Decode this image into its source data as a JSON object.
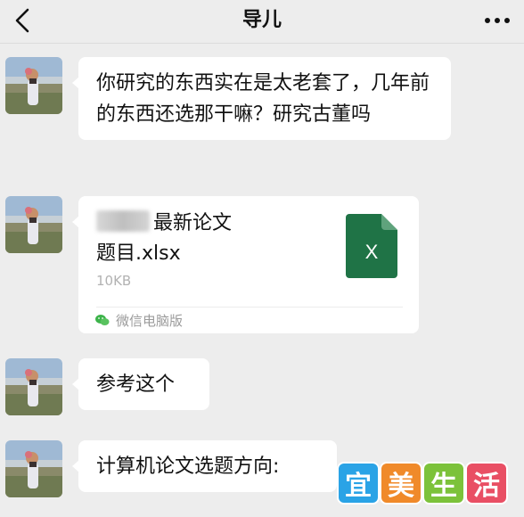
{
  "header": {
    "title": "导儿"
  },
  "messages": {
    "m1": "你研究的东西实在是太老套了，几年前的东西还选那干嘛？研究古董吗",
    "file": {
      "name_line1": "最新论文",
      "name_line2": "题目.xlsx",
      "size": "10KB",
      "source": "微信电脑版",
      "badge": "X"
    },
    "m3": "参考这个",
    "m4": "计算机论文选题方向:"
  },
  "watermark": {
    "chars": [
      "宜",
      "美",
      "生",
      "活"
    ],
    "colors": [
      "#2aa3e6",
      "#f08a2a",
      "#7cc23a",
      "#e94f64"
    ]
  },
  "colors": {
    "background": "#ededed",
    "bubble": "#ffffff",
    "excel": "#1f7346"
  }
}
